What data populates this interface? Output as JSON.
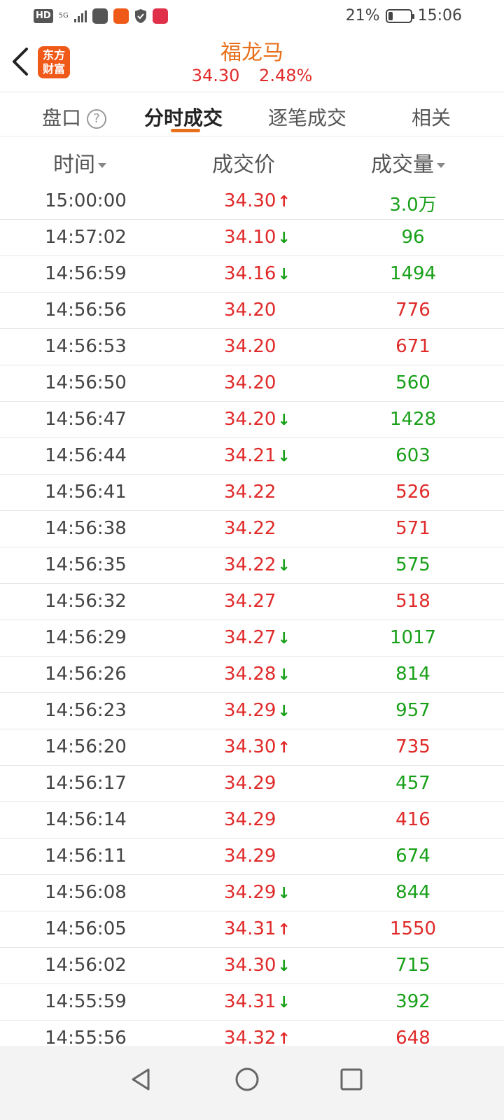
{
  "status_bar": {
    "hd": "HD",
    "network": "5G",
    "battery_percent": "21%",
    "battery_level": 0.21,
    "time": "15:06"
  },
  "header": {
    "logo_line1": "东方",
    "logo_line2": "财富",
    "stock_name": "福龙马",
    "price": "34.30",
    "change_pct": "2.48%"
  },
  "tabs": {
    "items": [
      "盘口",
      "分时成交",
      "逐笔成交",
      "相关"
    ],
    "help": "?",
    "active_index": 1
  },
  "columns": {
    "time": "时间",
    "price": "成交价",
    "volume": "成交量"
  },
  "colors": {
    "up": "#e02a2a",
    "down": "#19a019",
    "accent": "#e8701a"
  },
  "trades": [
    {
      "time": "15:00:00",
      "price": "34.30",
      "dir": "up",
      "volume": "3.0万",
      "vcolor": "green"
    },
    {
      "time": "14:57:02",
      "price": "34.10",
      "dir": "down",
      "volume": "96",
      "vcolor": "green"
    },
    {
      "time": "14:56:59",
      "price": "34.16",
      "dir": "down",
      "volume": "1494",
      "vcolor": "green"
    },
    {
      "time": "14:56:56",
      "price": "34.20",
      "dir": "",
      "volume": "776",
      "vcolor": "red"
    },
    {
      "time": "14:56:53",
      "price": "34.20",
      "dir": "",
      "volume": "671",
      "vcolor": "red"
    },
    {
      "time": "14:56:50",
      "price": "34.20",
      "dir": "",
      "volume": "560",
      "vcolor": "green"
    },
    {
      "time": "14:56:47",
      "price": "34.20",
      "dir": "down",
      "volume": "1428",
      "vcolor": "green"
    },
    {
      "time": "14:56:44",
      "price": "34.21",
      "dir": "down",
      "volume": "603",
      "vcolor": "green"
    },
    {
      "time": "14:56:41",
      "price": "34.22",
      "dir": "",
      "volume": "526",
      "vcolor": "red"
    },
    {
      "time": "14:56:38",
      "price": "34.22",
      "dir": "",
      "volume": "571",
      "vcolor": "red"
    },
    {
      "time": "14:56:35",
      "price": "34.22",
      "dir": "down",
      "volume": "575",
      "vcolor": "green"
    },
    {
      "time": "14:56:32",
      "price": "34.27",
      "dir": "",
      "volume": "518",
      "vcolor": "red"
    },
    {
      "time": "14:56:29",
      "price": "34.27",
      "dir": "down",
      "volume": "1017",
      "vcolor": "green"
    },
    {
      "time": "14:56:26",
      "price": "34.28",
      "dir": "down",
      "volume": "814",
      "vcolor": "green"
    },
    {
      "time": "14:56:23",
      "price": "34.29",
      "dir": "down",
      "volume": "957",
      "vcolor": "green"
    },
    {
      "time": "14:56:20",
      "price": "34.30",
      "dir": "up",
      "volume": "735",
      "vcolor": "red"
    },
    {
      "time": "14:56:17",
      "price": "34.29",
      "dir": "",
      "volume": "457",
      "vcolor": "green"
    },
    {
      "time": "14:56:14",
      "price": "34.29",
      "dir": "",
      "volume": "416",
      "vcolor": "red"
    },
    {
      "time": "14:56:11",
      "price": "34.29",
      "dir": "",
      "volume": "674",
      "vcolor": "green"
    },
    {
      "time": "14:56:08",
      "price": "34.29",
      "dir": "down",
      "volume": "844",
      "vcolor": "green"
    },
    {
      "time": "14:56:05",
      "price": "34.31",
      "dir": "up",
      "volume": "1550",
      "vcolor": "red"
    },
    {
      "time": "14:56:02",
      "price": "34.30",
      "dir": "down",
      "volume": "715",
      "vcolor": "green"
    },
    {
      "time": "14:55:59",
      "price": "34.31",
      "dir": "down",
      "volume": "392",
      "vcolor": "green"
    },
    {
      "time": "14:55:56",
      "price": "34.32",
      "dir": "up",
      "volume": "648",
      "vcolor": "red"
    }
  ],
  "nav": {
    "back_icon": "triangle-back-icon",
    "home_icon": "circle-home-icon",
    "recents_icon": "square-recents-icon"
  }
}
